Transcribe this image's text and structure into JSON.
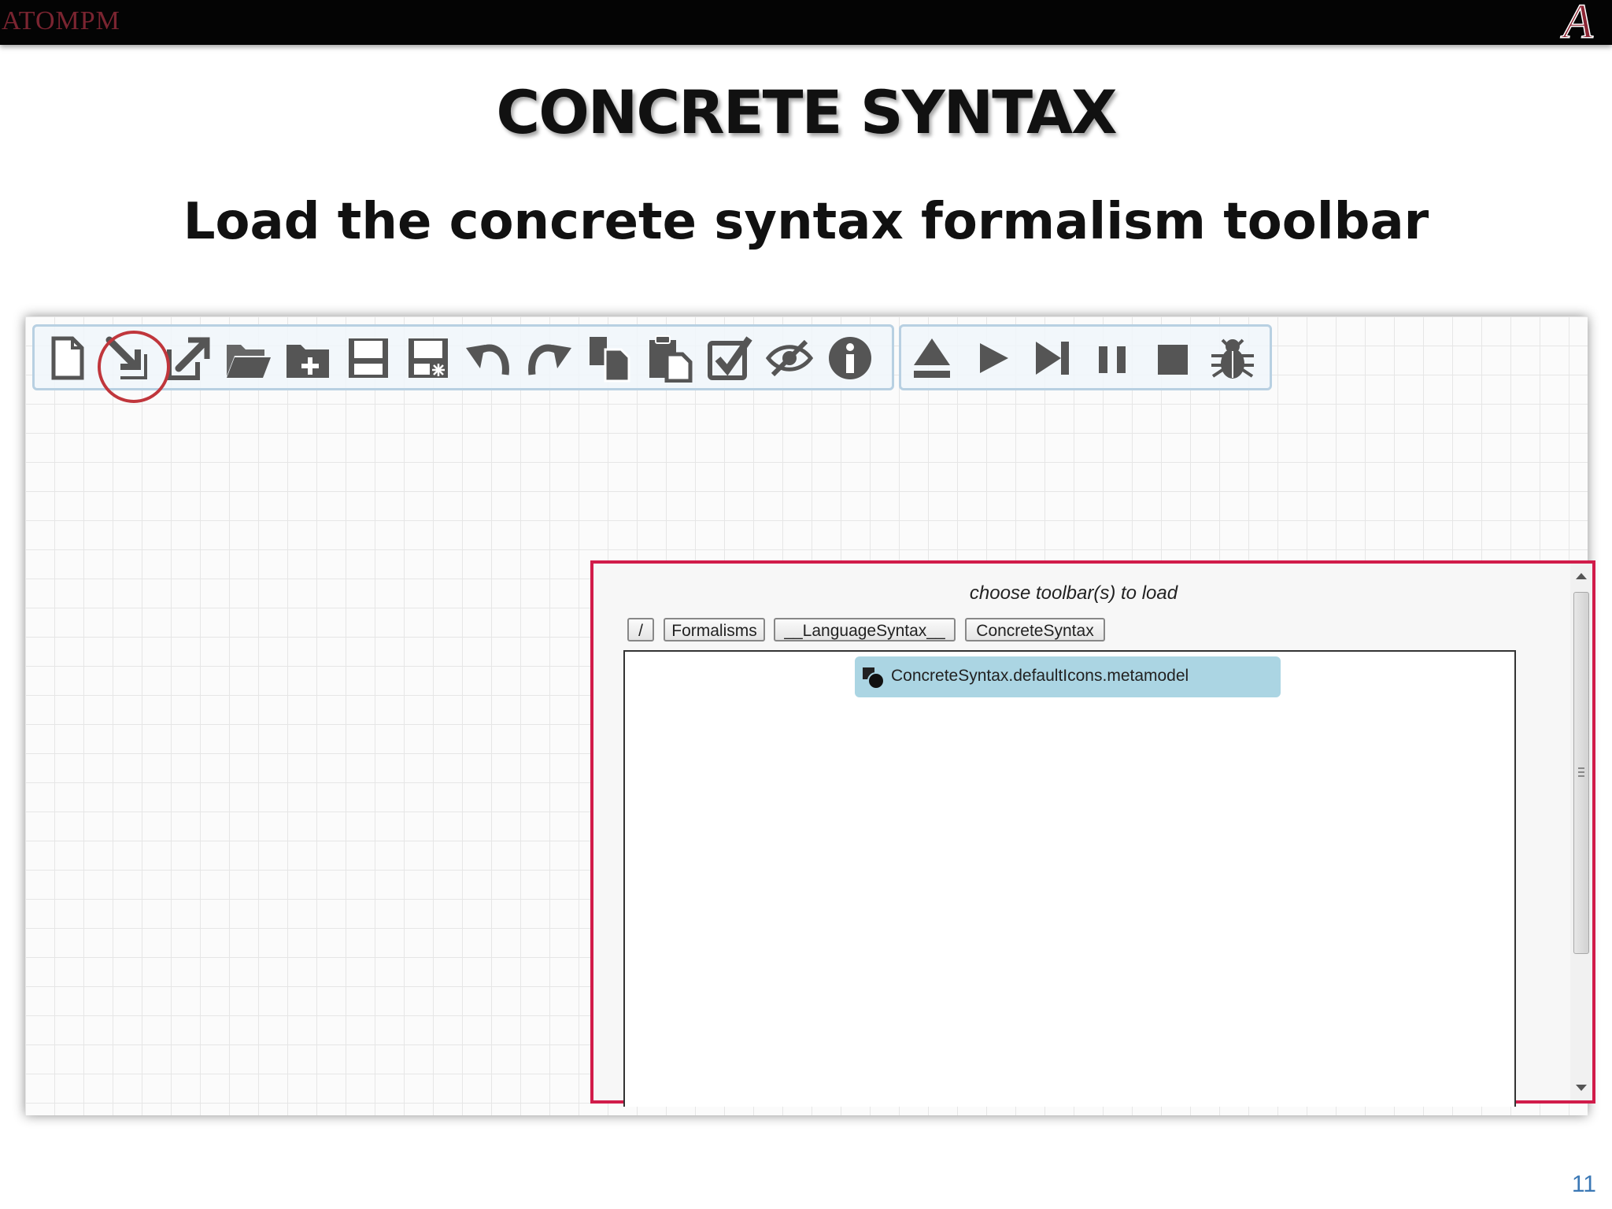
{
  "header": {
    "brand": "ATOMPM",
    "logo_icon": "university-a-logo-icon"
  },
  "slide": {
    "title": "CONCRETE SYNTAX",
    "subtitle": "Load the concrete syntax formalism toolbar",
    "page_number": "11"
  },
  "toolbar_main": {
    "buttons": [
      {
        "name": "new-model-icon"
      },
      {
        "name": "load-toolbar-icon",
        "highlighted": true
      },
      {
        "name": "export-icon"
      },
      {
        "name": "open-folder-icon"
      },
      {
        "name": "new-folder-icon"
      },
      {
        "name": "save-icon"
      },
      {
        "name": "save-as-icon"
      },
      {
        "name": "undo-icon"
      },
      {
        "name": "redo-icon"
      },
      {
        "name": "copy-icon"
      },
      {
        "name": "paste-icon"
      },
      {
        "name": "validate-icon"
      },
      {
        "name": "toggle-visibility-icon"
      },
      {
        "name": "info-icon"
      }
    ]
  },
  "toolbar_transform": {
    "buttons": [
      {
        "name": "eject-icon"
      },
      {
        "name": "play-icon"
      },
      {
        "name": "step-icon"
      },
      {
        "name": "pause-icon"
      },
      {
        "name": "stop-icon"
      },
      {
        "name": "debug-icon"
      }
    ]
  },
  "dialog": {
    "title": "choose toolbar(s) to load",
    "breadcrumb": [
      "/",
      "Formalisms",
      "__LanguageSyntax__",
      "ConcreteSyntax"
    ],
    "items": [
      {
        "label": "ConcreteSyntax.defaultIcons.metamodel",
        "selected": true
      }
    ]
  },
  "colors": {
    "dialog_border": "#d11c4a",
    "selected_item": "#abd5e3",
    "toolbar_border": "#b8d0e2",
    "highlight_ring": "#c0363c"
  }
}
